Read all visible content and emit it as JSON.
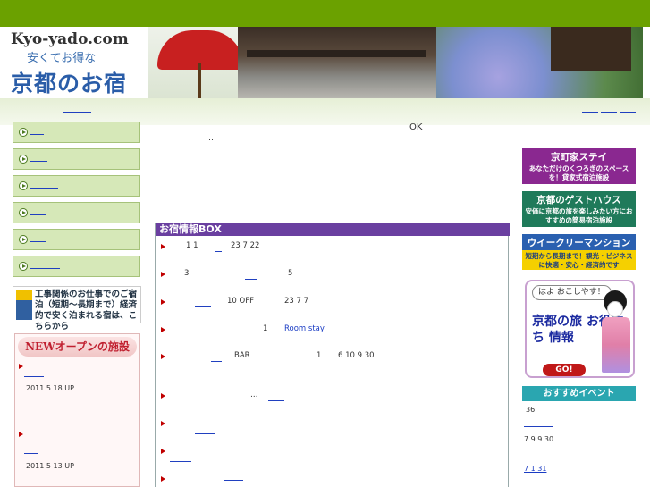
{
  "header": {
    "site": "Kyo-yado.com",
    "tagline": "安くてお得な",
    "title": "京都のお宿"
  },
  "work_banner": {
    "text": "工事関係のお仕事でのご宿泊（短期〜長期まで）経済的で安く泊まれる宿は、こちらから"
  },
  "new_box": {
    "title": "NEWオープンの施設",
    "entries": [
      {
        "date": "2011 5 18 UP"
      },
      {
        "date": "2011 5 13 UP"
      }
    ]
  },
  "main": {
    "ok": "OK",
    "ellipsis": "…"
  },
  "info_box": {
    "title": "お宿情報BOX",
    "rows": [
      {
        "a": "1 1",
        "b": "23 7 22"
      },
      {
        "a": "3",
        "b": "5"
      },
      {
        "a": "10 OFF",
        "b": "23 7 7"
      },
      {
        "a": "1",
        "link": "Room stay"
      },
      {
        "a": "BAR",
        "b": "1",
        "c": "6 10 9 30"
      },
      {
        "a": "…"
      }
    ]
  },
  "right_banners": {
    "machiya": {
      "title": "京町家ステイ",
      "sub": "あなただけのくつろぎのスペースを！貸家式宿泊施設"
    },
    "guesthouse": {
      "title": "京都のゲストハウス",
      "sub": "安価に京都の旅を楽しみたい方におすすめの簡易宿泊施設"
    },
    "weekly": {
      "title": "ウイークリーマンション",
      "sub": "短期から長期まで！観光・ビジネスに快適・安心・経済的です"
    },
    "guide": {
      "bubble": "はよ おこしやす！",
      "main": "京都の旅 お役立ち 情報",
      "go": "GO!"
    }
  },
  "events": {
    "title": "おすすめイベント",
    "items": [
      "36",
      "7 9 9 30",
      "7 1 31"
    ]
  }
}
